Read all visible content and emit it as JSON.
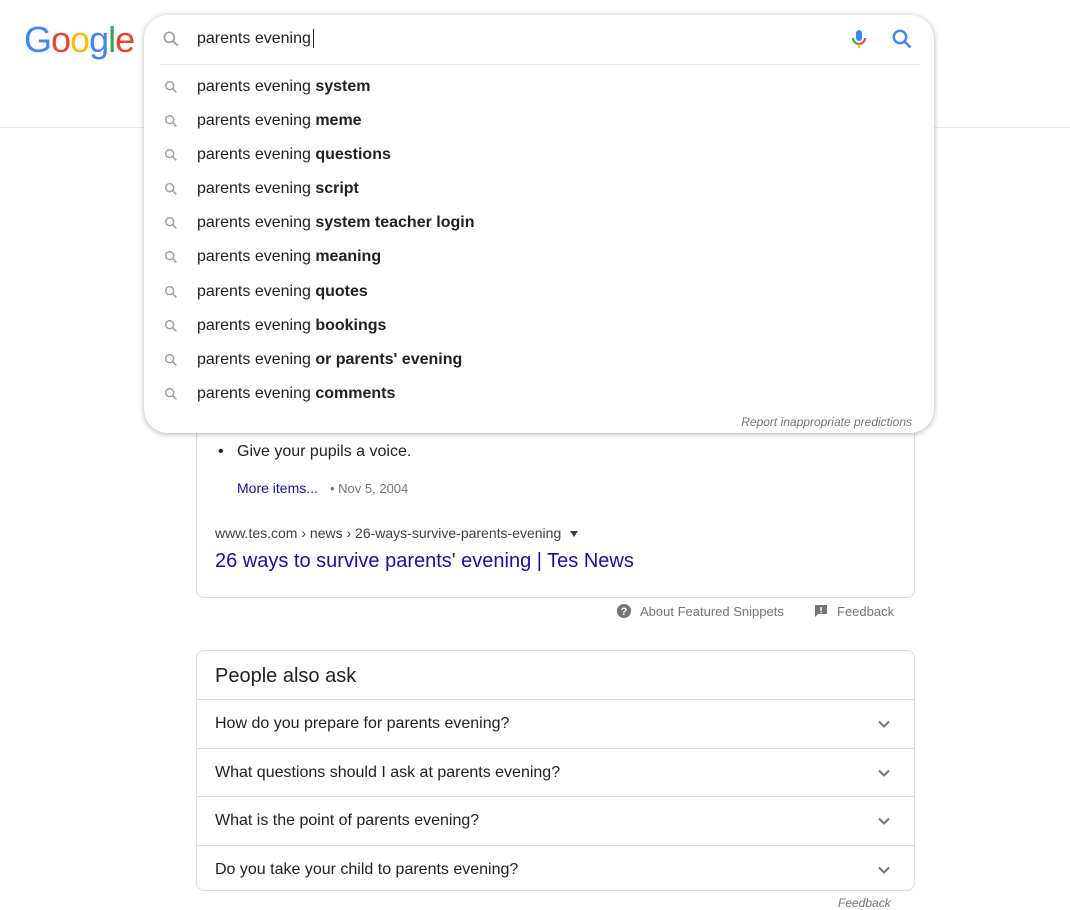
{
  "logo": {
    "letters": [
      "G",
      "o",
      "o",
      "g",
      "l",
      "e"
    ],
    "colors": [
      "#4285f4",
      "#ea4335",
      "#fbbc05",
      "#4285f4",
      "#34a853",
      "#ea4335"
    ],
    "text": "Google"
  },
  "search": {
    "query": "parents evening",
    "icons": {
      "left": "search-icon",
      "mic": "mic-icon",
      "submit": "search-icon"
    }
  },
  "suggestions": [
    {
      "prefix": "parents evening ",
      "bold": "system"
    },
    {
      "prefix": "parents evening ",
      "bold": "meme"
    },
    {
      "prefix": "parents evening ",
      "bold": "questions"
    },
    {
      "prefix": "parents evening ",
      "bold": "script"
    },
    {
      "prefix": "parents evening ",
      "bold": "system teacher login"
    },
    {
      "prefix": "parents evening ",
      "bold": "meaning"
    },
    {
      "prefix": "parents evening ",
      "bold": "quotes"
    },
    {
      "prefix": "parents evening ",
      "bold": "bookings"
    },
    {
      "prefix": "parents evening ",
      "bold": "or parents' evening"
    },
    {
      "prefix": "parents evening ",
      "bold": "comments"
    }
  ],
  "report_predictions": "Report inappropriate predictions",
  "snippet": {
    "bullet": "Give your pupils a voice.",
    "more_items": "More items...",
    "date": "• Nov 5, 2004",
    "cite": "www.tes.com › news › 26-ways-survive-parents-evening",
    "title": "26 ways to survive parents' evening | Tes News"
  },
  "about_snippets": "About Featured Snippets",
  "feedback": "Feedback",
  "paa": {
    "title": "People also ask",
    "questions": [
      "How do you prepare for parents evening?",
      "What questions should I ask at parents evening?",
      "What is the point of parents evening?",
      "Do you take your child to parents evening?"
    ]
  },
  "feedback_bottom": "Feedback",
  "colors": {
    "link": "#1a0dab",
    "muted": "#70757a",
    "border": "#dadce0"
  }
}
